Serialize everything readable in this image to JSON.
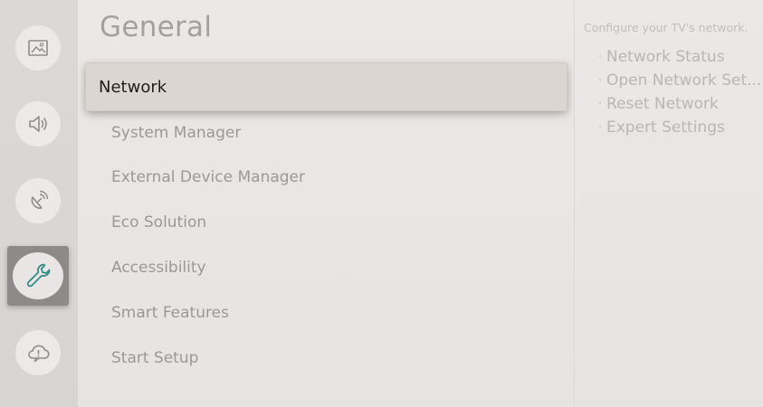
{
  "sidebar": {
    "icons": [
      "picture-icon",
      "sound-icon",
      "broadcasting-icon",
      "wrench-icon",
      "support-icon"
    ],
    "selected": "wrench-icon",
    "accent": "#2e8a86"
  },
  "main": {
    "title": "General",
    "selected_item": "Network",
    "items": [
      "System Manager",
      "External Device Manager",
      "Eco Solution",
      "Accessibility",
      "Smart Features",
      "Start Setup"
    ]
  },
  "help": {
    "description": "Configure your TV's network.",
    "bullets": [
      "Network Status",
      "Open Network Set...",
      "Reset Network",
      "Expert Settings"
    ]
  }
}
